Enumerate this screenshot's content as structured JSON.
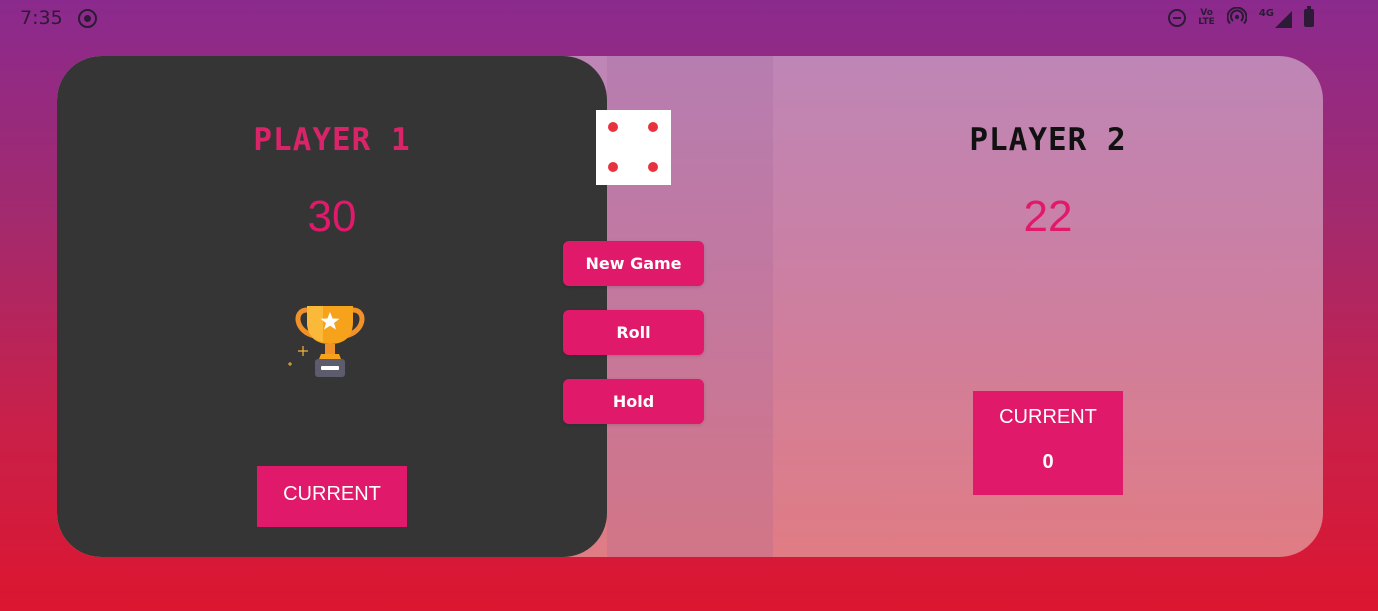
{
  "status_bar": {
    "time": "7:35",
    "network_label": "4G",
    "volte_line1": "Vo",
    "volte_line2": "LTE"
  },
  "players": [
    {
      "name": "PLAYER 1",
      "score": "30",
      "current_label": "CURRENT",
      "current_value": "",
      "winner": true
    },
    {
      "name": "PLAYER 2",
      "score": "22",
      "current_label": "CURRENT",
      "current_value": "0",
      "winner": false
    }
  ],
  "dice": {
    "value": 4,
    "pip_color": "#e8333f"
  },
  "controls": {
    "new_game": "New Game",
    "roll": "Roll",
    "hold": "Hold"
  },
  "colors": {
    "accent": "#e0196a",
    "active_panel": "#353535",
    "trophy": "#f7a21b"
  },
  "icons": [
    "record-icon",
    "dnd-icon",
    "volte-icon",
    "hotspot-icon",
    "signal-icon",
    "battery-icon",
    "trophy-icon"
  ]
}
